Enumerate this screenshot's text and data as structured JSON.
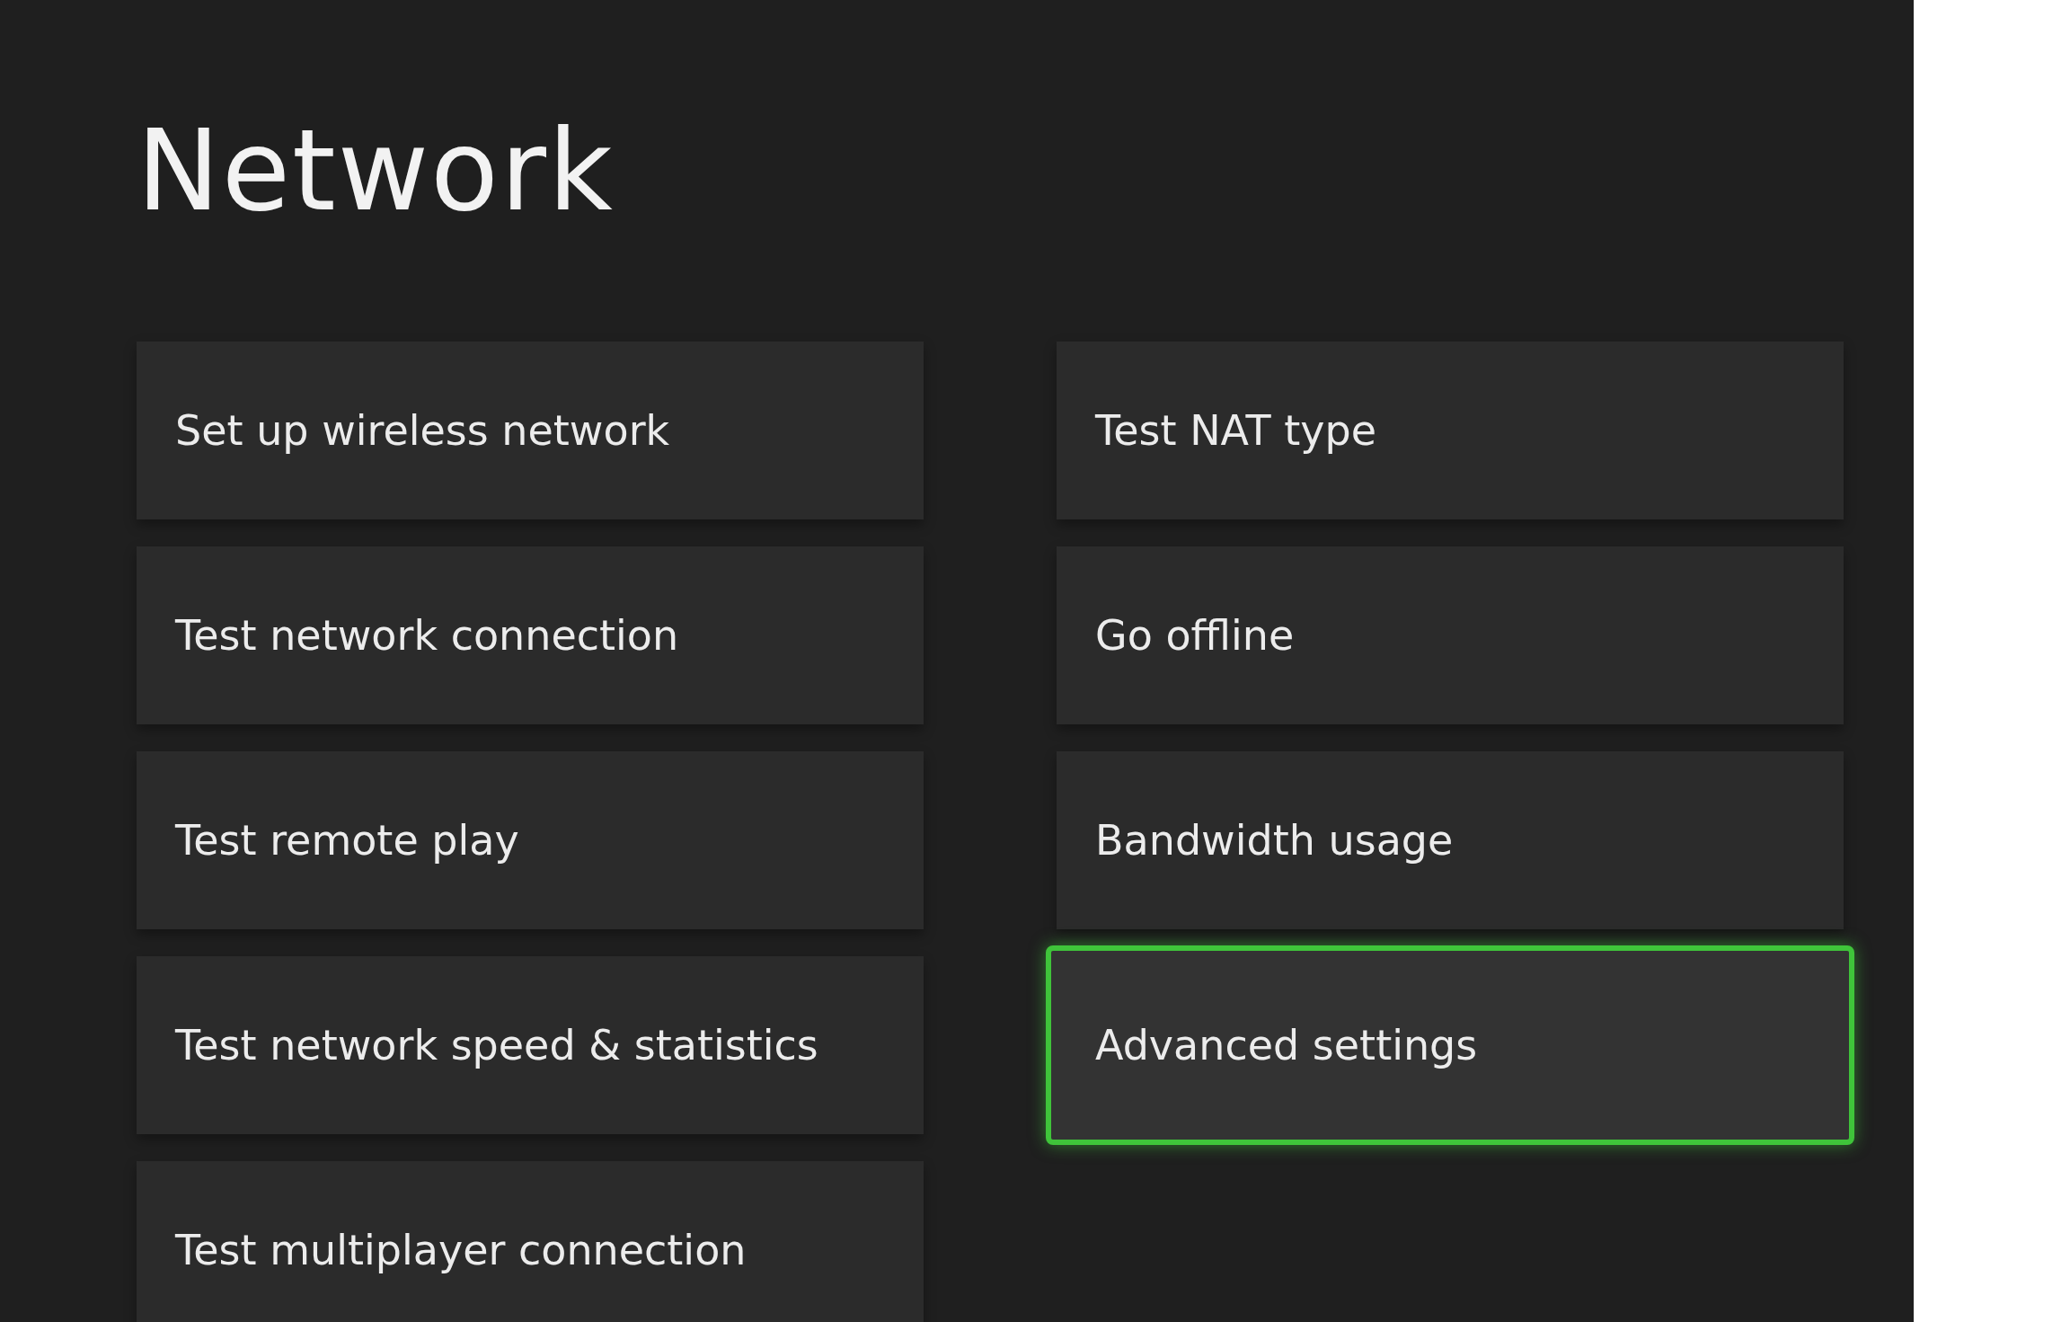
{
  "title": "Network",
  "columns": [
    {
      "tiles": [
        {
          "label": "Set up wireless network",
          "selected": false
        },
        {
          "label": "Test network connection",
          "selected": false
        },
        {
          "label": "Test remote play",
          "selected": false
        },
        {
          "label": "Test network speed & statistics",
          "selected": false
        },
        {
          "label": "Test multiplayer connection",
          "selected": false
        }
      ]
    },
    {
      "tiles": [
        {
          "label": "Test NAT type",
          "selected": false
        },
        {
          "label": "Go offline",
          "selected": false
        },
        {
          "label": "Bandwidth usage",
          "selected": false
        },
        {
          "label": "Advanced settings",
          "selected": true
        }
      ]
    }
  ]
}
